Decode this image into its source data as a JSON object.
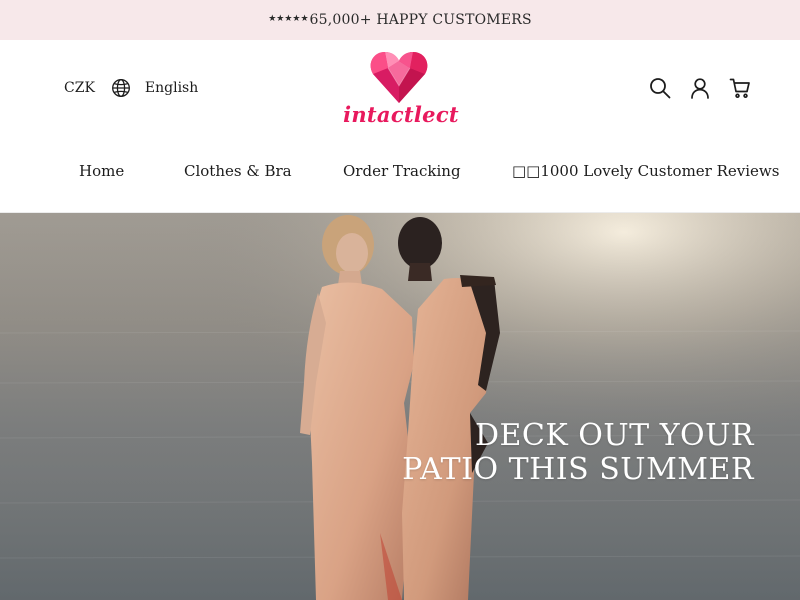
{
  "announcement": {
    "stars": "★★★★★",
    "text": "65,000+ HAPPY CUSTOMERS"
  },
  "header": {
    "currency": "CZK",
    "language": "English",
    "logo_text": "intactlect",
    "icons": [
      "globe-icon",
      "search-icon",
      "account-icon",
      "cart-icon"
    ]
  },
  "nav": {
    "items": [
      {
        "label": "Home"
      },
      {
        "label": "Clothes & Bra"
      },
      {
        "label": "Order Tracking"
      },
      {
        "label": "□□1000 Lovely Customer Reviews"
      }
    ]
  },
  "hero": {
    "heading_line1": "DECK OUT YOUR",
    "heading_line2": "PATIO THIS SUMMER"
  },
  "colors": {
    "announcement_bg": "#f7e8ea",
    "brand_pink": "#e8195d",
    "text": "#1c1c1c"
  }
}
